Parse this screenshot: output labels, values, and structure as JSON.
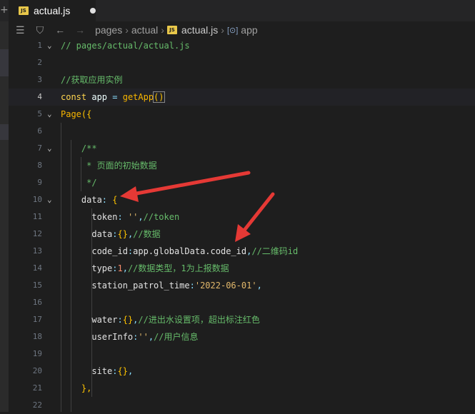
{
  "tab": {
    "badge": "JS",
    "label": "actual.js"
  },
  "breadcrumb": {
    "items": [
      "pages",
      "actual",
      "actual.js",
      "app"
    ],
    "badge": "JS",
    "symbol": "[⊙]"
  },
  "lines": [
    {
      "n": "1",
      "fold": "⌄",
      "tokens": [
        [
          "cmt",
          "// pages/actual/actual.js"
        ]
      ]
    },
    {
      "n": "2",
      "tokens": []
    },
    {
      "n": "3",
      "tokens": [
        [
          "cmt",
          "//获取应用实例"
        ]
      ]
    },
    {
      "n": "4",
      "active": true,
      "tokens": [
        [
          "kw",
          "const"
        ],
        [
          "var",
          " app "
        ],
        [
          "pun",
          "="
        ],
        [
          "var",
          " "
        ],
        [
          "fn",
          "getApp"
        ],
        [
          "sel",
          "()"
        ]
      ]
    },
    {
      "n": "5",
      "fold": "⌄",
      "tokens": [
        [
          "fn",
          "Page"
        ],
        [
          "br",
          "({"
        ]
      ]
    },
    {
      "n": "6",
      "tokens": []
    },
    {
      "n": "7",
      "fold": "⌄",
      "tokens": [
        [
          "cmt",
          "    /**"
        ]
      ]
    },
    {
      "n": "8",
      "tokens": [
        [
          "cmt",
          "     * 页面的初始数据"
        ]
      ]
    },
    {
      "n": "9",
      "tokens": [
        [
          "cmt",
          "     */"
        ]
      ]
    },
    {
      "n": "10",
      "fold": "⌄",
      "tokens": [
        [
          "prop",
          "    data"
        ],
        [
          "pun",
          ": "
        ],
        [
          "br",
          "{"
        ]
      ]
    },
    {
      "n": "11",
      "tokens": [
        [
          "prop",
          "      token"
        ],
        [
          "pun",
          ": "
        ],
        [
          "str",
          "''"
        ],
        [
          "pun",
          ","
        ],
        [
          "cmt",
          "//token"
        ]
      ]
    },
    {
      "n": "12",
      "tokens": [
        [
          "prop",
          "      data"
        ],
        [
          "pun",
          ":"
        ],
        [
          "br",
          "{}"
        ],
        [
          "pun",
          ","
        ],
        [
          "cmt",
          "//数据"
        ]
      ]
    },
    {
      "n": "13",
      "tokens": [
        [
          "prop",
          "      code_id"
        ],
        [
          "pun",
          ":"
        ],
        [
          "prop",
          "app.globalData.code_id"
        ],
        [
          "pun",
          ","
        ],
        [
          "cmt",
          "//二维码id"
        ]
      ]
    },
    {
      "n": "14",
      "tokens": [
        [
          "prop",
          "      type"
        ],
        [
          "pun",
          ":"
        ],
        [
          "num",
          "1"
        ],
        [
          "pun",
          ","
        ],
        [
          "cmt",
          "//数据类型，1为上报数据"
        ]
      ]
    },
    {
      "n": "15",
      "tokens": [
        [
          "prop",
          "      station_patrol_time"
        ],
        [
          "pun",
          ":"
        ],
        [
          "str",
          "'2022-06-01'"
        ],
        [
          "pun",
          ","
        ]
      ]
    },
    {
      "n": "16",
      "tokens": []
    },
    {
      "n": "17",
      "tokens": [
        [
          "prop",
          "      water"
        ],
        [
          "pun",
          ":"
        ],
        [
          "br",
          "{}"
        ],
        [
          "pun",
          ","
        ],
        [
          "cmt",
          "//进出水设置项，超出标注红色"
        ]
      ]
    },
    {
      "n": "18",
      "tokens": [
        [
          "prop",
          "      userInfo"
        ],
        [
          "pun",
          ":"
        ],
        [
          "str",
          "''"
        ],
        [
          "pun",
          ","
        ],
        [
          "cmt",
          "//用户信息"
        ]
      ]
    },
    {
      "n": "19",
      "tokens": []
    },
    {
      "n": "20",
      "tokens": [
        [
          "prop",
          "      site"
        ],
        [
          "pun",
          ":"
        ],
        [
          "br",
          "{}"
        ],
        [
          "pun",
          ","
        ]
      ]
    },
    {
      "n": "21",
      "tokens": [
        [
          "br",
          "    },"
        ]
      ]
    },
    {
      "n": "22",
      "tokens": []
    }
  ],
  "colors": {
    "background": "#1e1e1e",
    "tab_bg": "#252526",
    "arrow": "#e53935"
  }
}
